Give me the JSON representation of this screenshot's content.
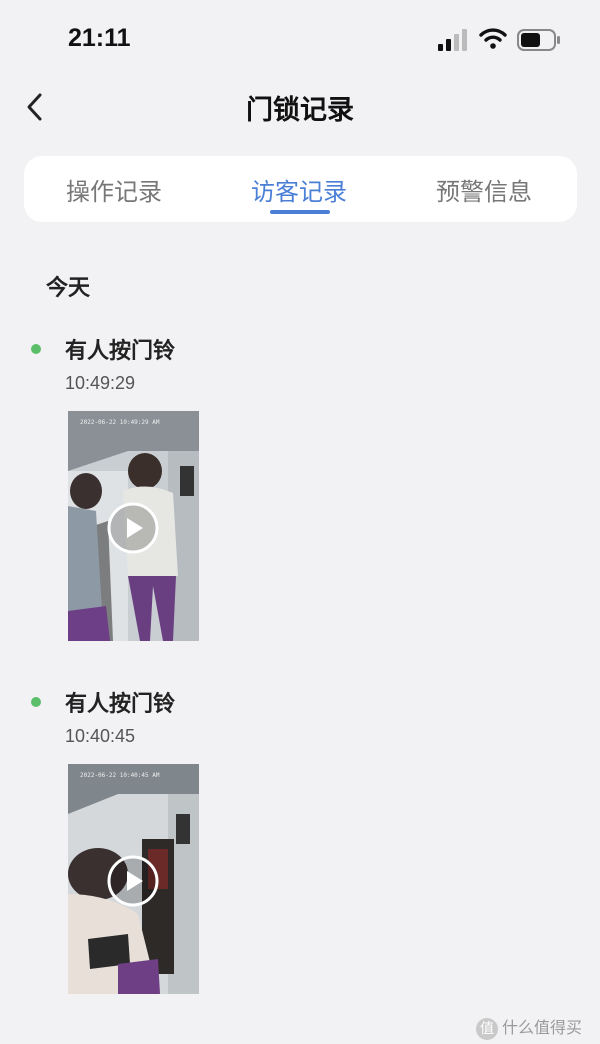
{
  "status_bar": {
    "time": "21:11",
    "icons": [
      "signal-icon",
      "wifi-icon",
      "battery-icon"
    ]
  },
  "nav": {
    "back_icon": "chevron-left-icon",
    "title": "门锁记录"
  },
  "tabs": [
    {
      "label": "操作记录",
      "active": false
    },
    {
      "label": "访客记录",
      "active": true
    },
    {
      "label": "预警信息",
      "active": false
    }
  ],
  "section_date": "今天",
  "records": [
    {
      "title": "有人按门铃",
      "time": "10:49:29",
      "thumb_stamp": "2022-06-22 10:49:29 AM"
    },
    {
      "title": "有人按门铃",
      "time": "10:40:45",
      "thumb_stamp": "2022-06-22 10:40:45 AM"
    }
  ],
  "watermark": {
    "badge": "值",
    "text": "什么值得买"
  },
  "colors": {
    "accent": "#4b7fd6",
    "dot": "#5bbf6a",
    "background": "#f2f2f5"
  }
}
